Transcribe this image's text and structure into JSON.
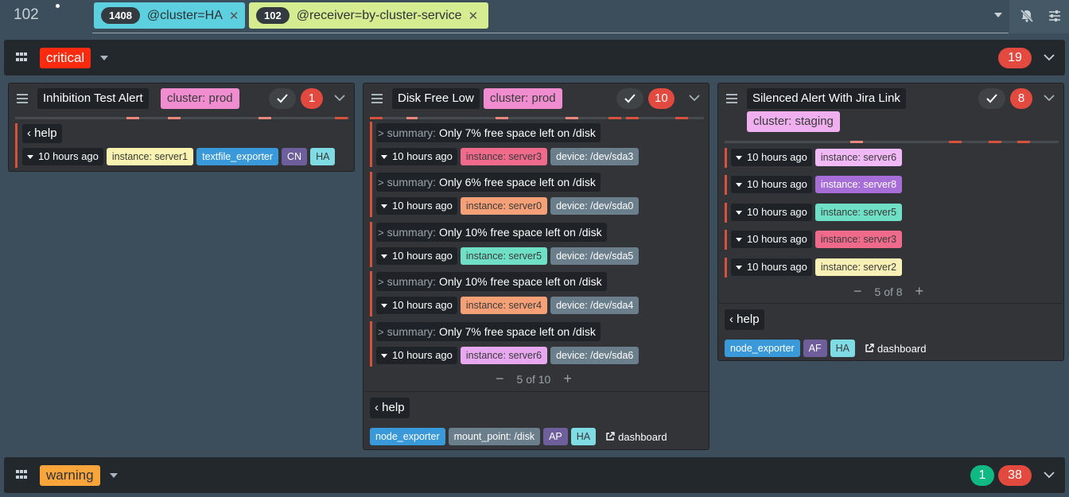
{
  "topbar": {
    "total": "102",
    "filters": [
      {
        "count": "1408",
        "text": "@cluster=HA"
      },
      {
        "count": "102",
        "text": "@receiver=by-cluster-service"
      }
    ]
  },
  "groups": {
    "critical": {
      "label": "critical",
      "count": "19"
    },
    "warning": {
      "label": "warning",
      "count_ok": "1",
      "count": "38"
    }
  },
  "cards": [
    {
      "name": "Inhibition Test Alert",
      "cluster": "cluster: prod",
      "count": "1",
      "help": "help",
      "alerts": [
        {
          "ago": "10 hours ago",
          "labels": [
            "instance: server1",
            "textfile_exporter",
            "CN",
            "HA"
          ]
        }
      ]
    },
    {
      "name": "Disk Free Low",
      "cluster": "cluster: prod",
      "count": "10",
      "summary_key": "summary:",
      "alerts": [
        {
          "summary": "Only 7% free space left on /disk",
          "ago": "10 hours ago",
          "instance": "instance: server3",
          "device": "device: /dev/sda3"
        },
        {
          "summary": "Only 6% free space left on /disk",
          "ago": "10 hours ago",
          "instance": "instance: server0",
          "device": "device: /dev/sda0"
        },
        {
          "summary": "Only 10% free space left on /disk",
          "ago": "10 hours ago",
          "instance": "instance: server5",
          "device": "device: /dev/sda5"
        },
        {
          "summary": "Only 10% free space left on /disk",
          "ago": "10 hours ago",
          "instance": "instance: server4",
          "device": "device: /dev/sda4"
        },
        {
          "summary": "Only 7% free space left on /disk",
          "ago": "10 hours ago",
          "instance": "instance: server6",
          "device": "device: /dev/sda6"
        }
      ],
      "pager": "5 of 10",
      "help": "help",
      "footer_labels": [
        "node_exporter",
        "mount_point: /disk",
        "AP",
        "HA"
      ],
      "dashboard": "dashboard"
    },
    {
      "name": "Silenced Alert With Jira Link",
      "cluster": "cluster: staging",
      "count": "8",
      "alerts": [
        {
          "ago": "10 hours ago",
          "instance": "instance: server6"
        },
        {
          "ago": "10 hours ago",
          "instance": "instance: server8"
        },
        {
          "ago": "10 hours ago",
          "instance": "instance: server5"
        },
        {
          "ago": "10 hours ago",
          "instance": "instance: server3"
        },
        {
          "ago": "10 hours ago",
          "instance": "instance: server2"
        }
      ],
      "pager": "5 of 8",
      "help": "help",
      "footer_labels": [
        "node_exporter",
        "AF",
        "HA"
      ],
      "dashboard": "dashboard"
    }
  ],
  "colors": {
    "critical": "#fa2b0f",
    "warning": "#faa53c",
    "count_red": "#e2493f",
    "count_green": "#10b981",
    "filter_cluster": "#5cd0de",
    "filter_receiver": "#d5ec91",
    "cluster_prod": "#f08cd0",
    "cluster_staging": "#f0b0f0"
  },
  "icons": [
    "grid-icon",
    "menu-icon",
    "check-icon",
    "chevron-down-icon",
    "bell-slash-icon",
    "sliders-icon",
    "chevron-left-icon",
    "chevron-right-icon",
    "external-link-icon"
  ]
}
